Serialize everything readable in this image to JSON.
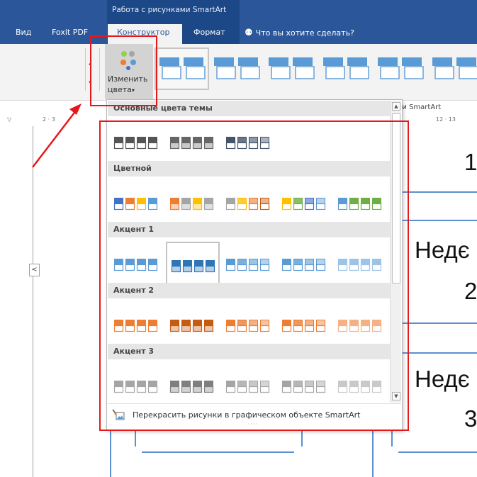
{
  "titlebar": {
    "context_label": "Работа с рисунками SmartArt",
    "tabs": [
      "Вид",
      "Foxit PDF",
      "Конструктор",
      "Формат"
    ],
    "search_placeholder": "Что вы хотите сделать?"
  },
  "ribbon": {
    "change_colors_line1": "Изменить",
    "change_colors_line2": "цвета",
    "change_colors_caret": "▾",
    "group_label": "ли SmartArt"
  },
  "ruler": {
    "text_left": "2 · 3",
    "text_right": "12 · 13"
  },
  "dropdown": {
    "sections": [
      {
        "header": "Основные цвета темы",
        "swatches": [
          [
            "#555555"
          ],
          [
            "#666666"
          ],
          [
            "#44546a"
          ]
        ]
      },
      {
        "header": "Цветной",
        "swatches": [
          [
            "#4472c4",
            "#ed7d31",
            "#ffc000",
            "#5b9bd5"
          ],
          [
            "#ed7d31",
            "#a5a5a5",
            "#ffc000",
            "#a5a5a5"
          ],
          [
            "#a5a5a5",
            "#ffc000",
            "#ed7d31",
            "#c55a11"
          ],
          [
            "#ffc000",
            "#70ad47",
            "#4472c4",
            "#5b9bd5"
          ],
          [
            "#5b9bd5",
            "#70ad47",
            "#70ad47",
            "#70ad47"
          ]
        ]
      },
      {
        "header": "Акцент 1",
        "swatches": [
          [
            "#5b9bd5"
          ],
          [
            "#2e75b6"
          ],
          [
            "#5b9bd5"
          ],
          [
            "#5b9bd5"
          ],
          [
            "#9dc3e6"
          ]
        ]
      },
      {
        "header": "Акцент 2",
        "swatches": [
          [
            "#ed7d31"
          ],
          [
            "#c55a11"
          ],
          [
            "#ed7d31"
          ],
          [
            "#ed7d31"
          ],
          [
            "#f4b183"
          ]
        ]
      },
      {
        "header": "Акцент 3",
        "swatches": [
          [
            "#a5a5a5"
          ],
          [
            "#7f7f7f"
          ],
          [
            "#a5a5a5"
          ],
          [
            "#a5a5a5"
          ],
          [
            "#c9c9c9"
          ]
        ]
      }
    ],
    "recolor_label": "Перекрасить рисунки в графическом объекте SmartArt",
    "grip": "····",
    "scroll_up": "▲",
    "scroll_down": "▼"
  },
  "document": {
    "collapse_glyph": "<",
    "right_texts": [
      "1",
      "Недє",
      "2",
      "Недє",
      "3"
    ]
  },
  "colors": {
    "title_blue": "#2b579a",
    "annotation_red": "#e8171b",
    "outline_blue": "#5b8fd0"
  }
}
